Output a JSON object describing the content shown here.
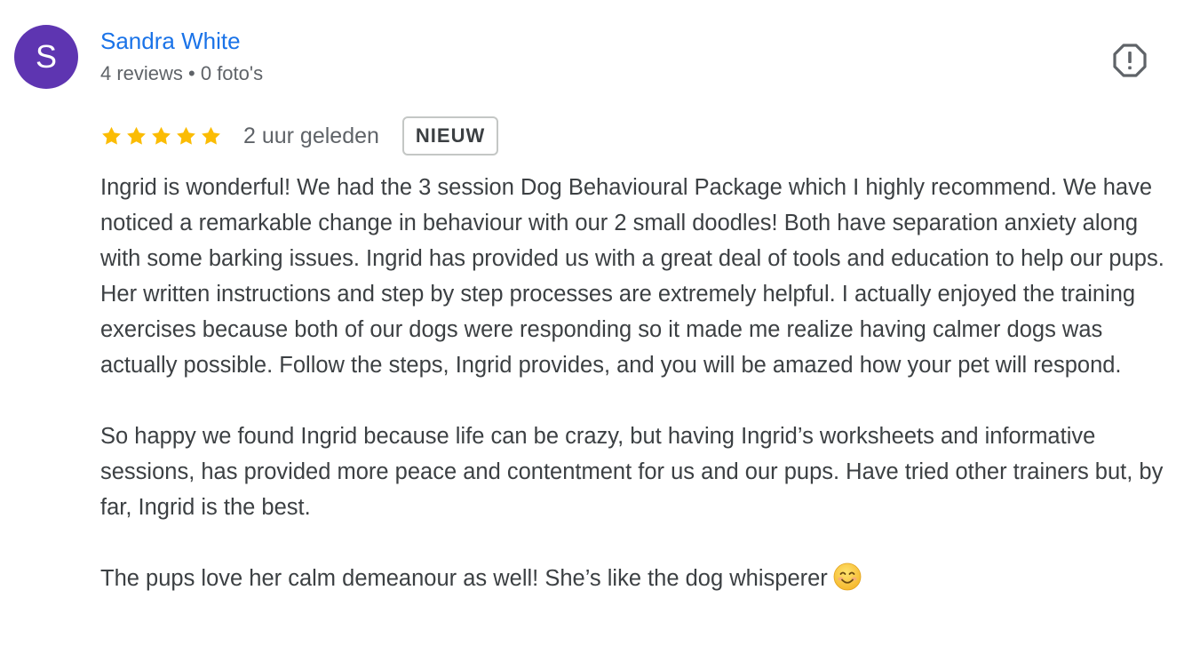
{
  "review": {
    "author": {
      "initial": "S",
      "name": "Sandra White",
      "meta": "4 reviews • 0 foto's",
      "avatar_color": "#5e35b1"
    },
    "report_icon": "report-flag-icon",
    "rating": {
      "stars": 5,
      "max_stars": 5,
      "star_color": "#fbbc04"
    },
    "timestamp": "2 uur geleden",
    "badge": "NIEUW",
    "paragraphs": [
      "Ingrid is wonderful! We had the 3 session Dog Behavioural Package which I highly recommend. We have noticed a remarkable change in behaviour with our 2 small doodles! Both have separation anxiety along with some barking issues. Ingrid has provided us with a great deal of tools and education to help our pups. Her written instructions and step by step processes are extremely helpful. I actually enjoyed the training exercises because both of our dogs were responding so it made me realize having calmer dogs was actually possible. Follow the steps, Ingrid provides, and you will be amazed how your pet will respond.",
      "So happy we found Ingrid because life can be crazy, but having Ingrid’s worksheets and informative sessions, has provided more peace and contentment for us and our pups. Have tried other trainers but, by far, Ingrid is the best.",
      "The pups love her calm demeanour as well! She’s like the dog whisperer"
    ],
    "trailing_emoji": "smiling-face-emoji"
  },
  "colors": {
    "link_blue": "#1a73e8",
    "text_primary": "#3c4043",
    "text_secondary": "#5f6368"
  }
}
